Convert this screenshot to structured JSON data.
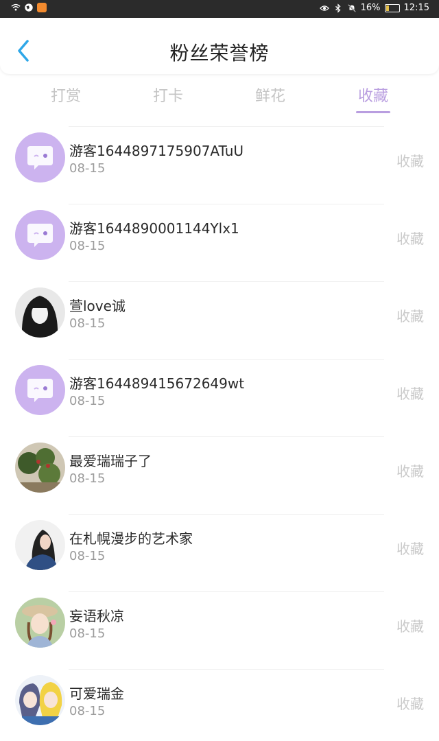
{
  "status_bar": {
    "battery": "16%",
    "time": "12:15"
  },
  "header": {
    "title": "粉丝荣誉榜",
    "back_icon": "chevron-left-icon",
    "accent_color": "#2ea7e8"
  },
  "tabs": [
    {
      "label": "打赏",
      "active": false
    },
    {
      "label": "打卡",
      "active": false
    },
    {
      "label": "鲜花",
      "active": false
    },
    {
      "label": "收藏",
      "active": true
    }
  ],
  "accent_color": "#b99ee0",
  "items": [
    {
      "name": "游客1644897175907ATuU",
      "date": "08-15",
      "action": "收藏",
      "avatar": "default-chat-avatar"
    },
    {
      "name": "游客1644890001144Ylx1",
      "date": "08-15",
      "action": "收藏",
      "avatar": "default-chat-avatar"
    },
    {
      "name": "萱love诚",
      "date": "08-15",
      "action": "收藏",
      "avatar": "photo-avatar"
    },
    {
      "name": "游客164489415672649wt",
      "date": "08-15",
      "action": "收藏",
      "avatar": "default-chat-avatar"
    },
    {
      "name": "最爱瑞瑞子了",
      "date": "08-15",
      "action": "收藏",
      "avatar": "photo-avatar"
    },
    {
      "name": "在札幌漫步的艺术家",
      "date": "08-15",
      "action": "收藏",
      "avatar": "photo-avatar"
    },
    {
      "name": "妄语秋凉",
      "date": "08-15",
      "action": "收藏",
      "avatar": "photo-avatar"
    },
    {
      "name": "可爱瑞金",
      "date": "08-15",
      "action": "收藏",
      "avatar": "photo-avatar"
    }
  ]
}
